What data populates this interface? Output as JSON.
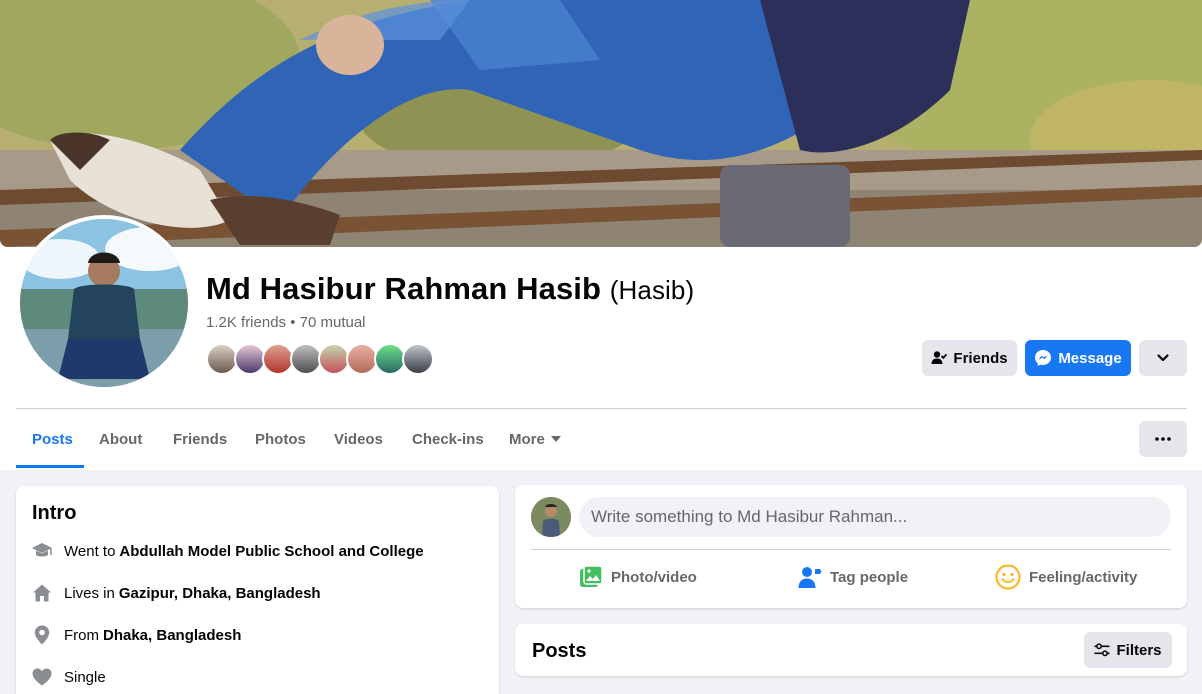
{
  "profile": {
    "name": "Md Hasibur Rahman Hasib",
    "nickname": "(Hasib)",
    "friends_summary": "1.2K friends • 70 mutual"
  },
  "actions": {
    "friends_label": "Friends",
    "message_label": "Message"
  },
  "tabs": [
    {
      "label": "Posts",
      "active": true
    },
    {
      "label": "About"
    },
    {
      "label": "Friends"
    },
    {
      "label": "Photos"
    },
    {
      "label": "Videos"
    },
    {
      "label": "Check-ins"
    },
    {
      "label": "More"
    }
  ],
  "intro": {
    "title": "Intro",
    "items": [
      {
        "icon": "graduation-cap-icon",
        "prefix": "Went to",
        "value": "Abdullah Model Public School and College"
      },
      {
        "icon": "home-icon",
        "prefix": "Lives in",
        "value": "Gazipur, Dhaka, Bangladesh"
      },
      {
        "icon": "location-pin-icon",
        "prefix": "From",
        "value": "Dhaka, Bangladesh"
      },
      {
        "icon": "heart-icon",
        "prefix": "Single",
        "value": ""
      }
    ]
  },
  "composer": {
    "placeholder": "Write something to Md Hasibur Rahman...",
    "photo_video": "Photo/video",
    "tag_people": "Tag people",
    "feeling_activity": "Feeling/activity"
  },
  "posts": {
    "title": "Posts",
    "filters_label": "Filters"
  },
  "colors": {
    "accent": "#1877f2",
    "page_bg": "#f0f2f5",
    "secondary_text": "#65676b",
    "photo_green": "#45bd62",
    "tag_blue": "#1877f2",
    "feeling_yellow": "#f7b928"
  }
}
